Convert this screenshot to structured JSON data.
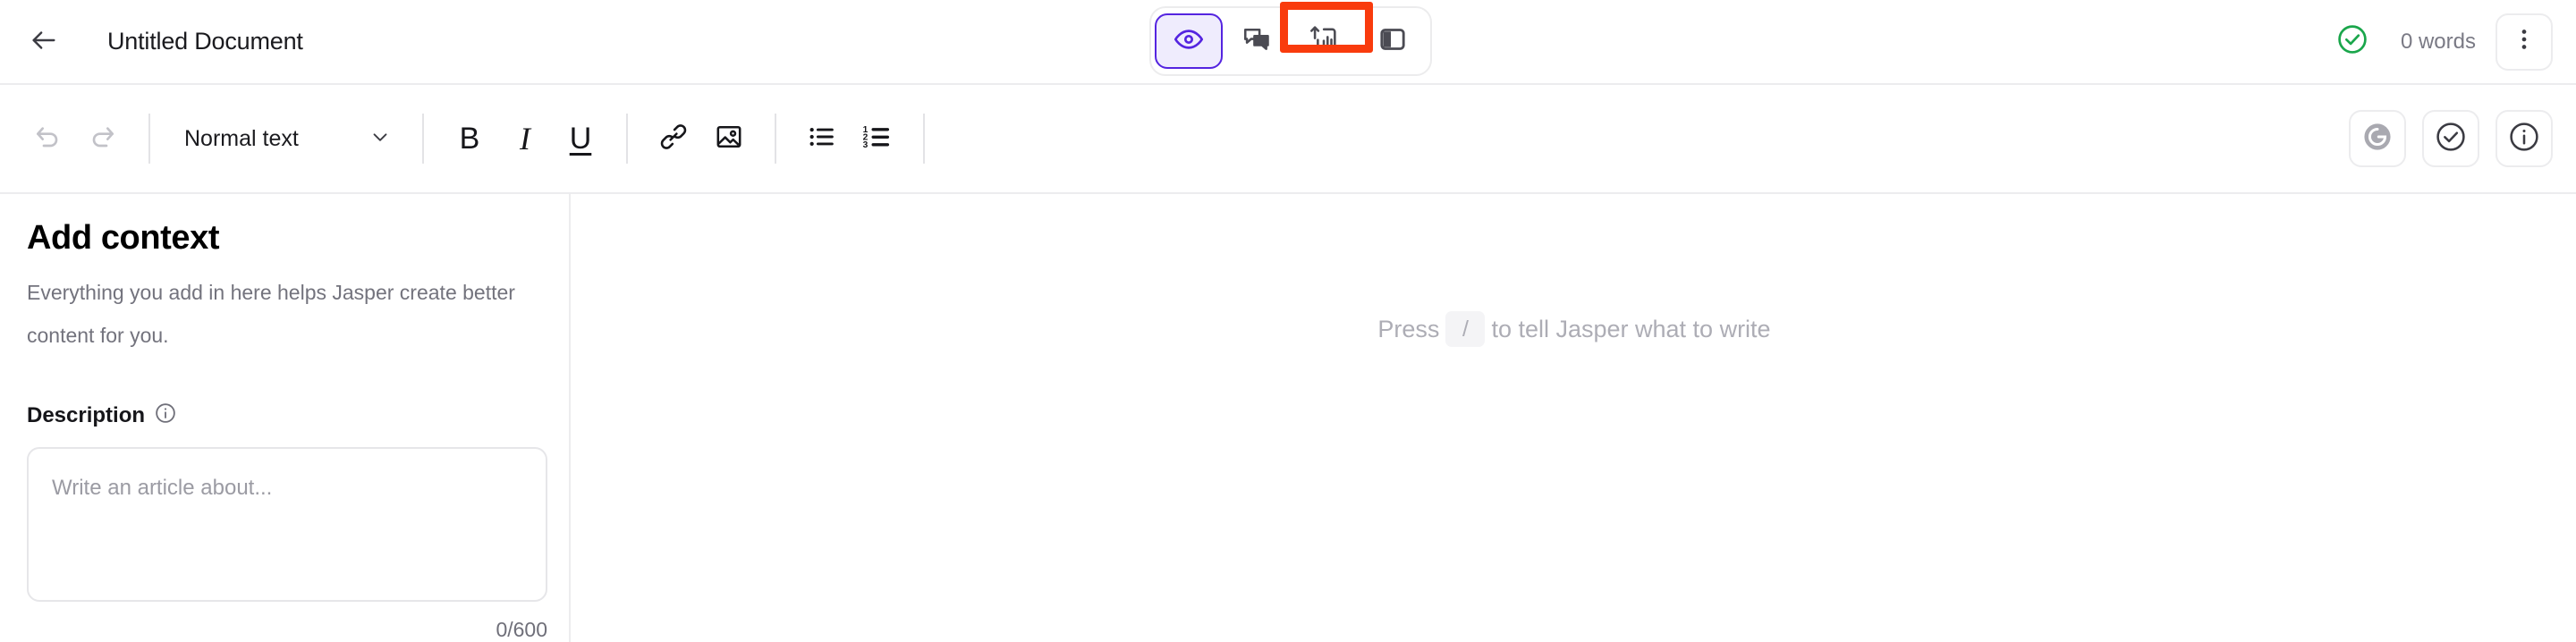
{
  "header": {
    "back_icon": "arrow-left-icon",
    "title": "Untitled Document",
    "view_modes": [
      {
        "id": "preview",
        "icon": "eye-icon",
        "active": true
      },
      {
        "id": "comments",
        "icon": "comment-bubbles-icon",
        "active": false
      },
      {
        "id": "analytics",
        "icon": "chart-upload-icon",
        "active": false,
        "highlighted": true
      },
      {
        "id": "panel",
        "icon": "side-panel-icon",
        "active": false
      }
    ],
    "status_icon": "check-circle-icon",
    "word_count": "0 words",
    "more_icon": "more-vertical-icon"
  },
  "toolbar": {
    "undo_icon": "undo-icon",
    "redo_icon": "redo-icon",
    "text_style": "Normal text",
    "chevron_icon": "chevron-down-icon",
    "bold_label": "B",
    "italic_label": "I",
    "underline_label": "U",
    "link_icon": "link-icon",
    "image_icon": "image-icon",
    "bullet_list_icon": "bullet-list-icon",
    "numbered_list_icon": "numbered-list-icon",
    "grammarly_icon": "grammarly-icon",
    "check_icon": "check-circle-icon",
    "info_icon": "info-circle-icon"
  },
  "sidebar": {
    "title": "Add context",
    "subtitle": "Everything you add in here helps Jasper create better content for you.",
    "description_label": "Description",
    "description_info_icon": "info-circle-icon",
    "description_value": "",
    "description_placeholder": "Write an article about...",
    "description_counter": "0/600"
  },
  "canvas": {
    "placeholder_prefix": "Press",
    "placeholder_key": "/",
    "placeholder_suffix": "to tell Jasper what to write"
  },
  "colors": {
    "accent_purple": "#5424e0",
    "accent_purple_bg": "#efecfd",
    "highlight_red": "#f93b0d",
    "status_green": "#1aa64b",
    "border": "#ececee",
    "muted_text": "#73737d"
  }
}
